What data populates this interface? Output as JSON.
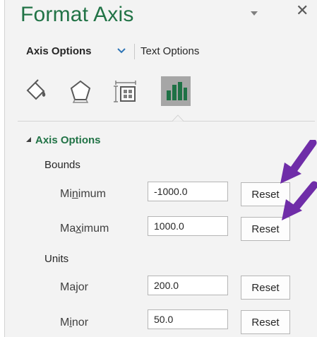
{
  "pane": {
    "title": "Format Axis",
    "tabs": {
      "axis_options": "Axis Options",
      "text_options": "Text Options"
    },
    "icons": [
      "fill-line-icon",
      "effects-icon",
      "size-properties-icon",
      "axis-options-icon"
    ],
    "active_icon": "axis-options-icon"
  },
  "section": {
    "title": "Axis Options",
    "bounds": {
      "label": "Bounds",
      "minimum": {
        "pre": "Mi",
        "ul": "n",
        "post": "imum",
        "value": "-1000.0",
        "reset": "Reset"
      },
      "maximum": {
        "pre": "Ma",
        "ul": "x",
        "post": "imum",
        "value": "1000.0",
        "reset": "Reset"
      }
    },
    "units": {
      "label": "Units",
      "major": {
        "pre": "Major",
        "ul": "",
        "post": "",
        "value": "200.0",
        "reset": "Reset"
      },
      "minor": {
        "pre": "M",
        "ul": "i",
        "post": "nor",
        "value": "50.0",
        "reset": "Reset"
      }
    }
  },
  "colors": {
    "accent": "#217346",
    "annotation_arrow": "#6f2da8"
  }
}
